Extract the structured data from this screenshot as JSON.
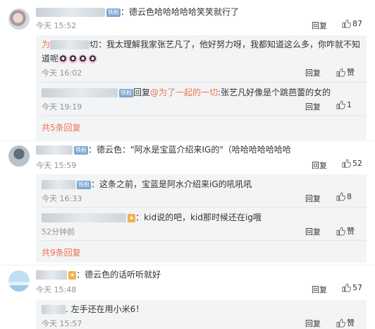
{
  "common": {
    "reply": "回复",
    "like": "赞",
    "fan_label": "铁粉"
  },
  "comments": [
    {
      "text": "：德云色哈哈哈哈哈笑笑就行了",
      "time": "今天 15:52",
      "likes": "87",
      "replies": [
        {
          "prefix": "为",
          "text": "切：我太理解我家张艺凡了，他好努力呀，我都知道这么多，你咋就不知道呢",
          "time": "今天 16:02",
          "likes": ""
        },
        {
          "prefix": "",
          "text_pre": "回复",
          "mention": "@为了一起的一切",
          "text": ":张艺凡好像是个跳芭蕾的女的",
          "time": "今天 19:19",
          "likes": "1"
        }
      ],
      "more": "共5条回复"
    },
    {
      "text": "：德云色：\"阿水是宝蓝介绍来IG的\"（哈哈哈哈哈哈哈",
      "time": "今天 15:59",
      "likes": "52",
      "replies": [
        {
          "text": "：这条之前，宝蓝是阿水介绍来iG的吼吼吼",
          "time": "今天 16:33",
          "likes": "8"
        },
        {
          "text": "：kid说的吧，kid那时候还在ig哦",
          "time": "52分钟前",
          "likes": ""
        }
      ],
      "more": "共9条回复"
    },
    {
      "text": "：德云色的话听听就好",
      "time": "今天 15:48",
      "likes": "57",
      "replies": [
        {
          "text": ". 左手还在用小米6！",
          "time": "今天 15:57",
          "likes": ""
        }
      ]
    }
  ]
}
